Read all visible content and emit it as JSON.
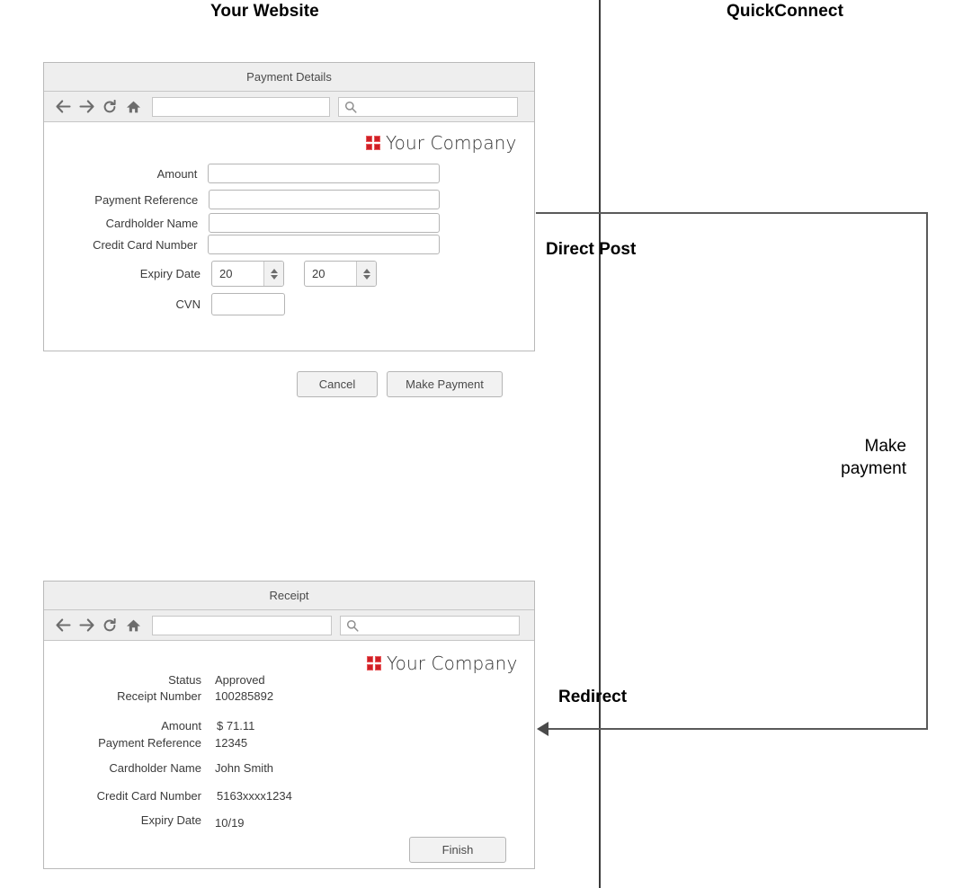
{
  "diagram": {
    "columns": {
      "left_title": "Your Website",
      "right_title": "QuickConnect"
    },
    "flows": [
      {
        "label": "Direct Post",
        "direction": "left-to-right"
      },
      {
        "label": "Redirect",
        "direction": "right-to-left"
      }
    ],
    "right_annotation": "Make\npayment",
    "right_annotation_line1": "Make",
    "right_annotation_line2": "payment"
  },
  "payment_window": {
    "title": "Payment Details",
    "toolbar": {
      "back_icon": "arrow-left-icon",
      "forward_icon": "arrow-right-icon",
      "reload_icon": "reload-icon",
      "home_icon": "home-icon",
      "url_value": "",
      "url_placeholder": "",
      "search_value": "",
      "search_placeholder": "",
      "search_icon": "search-icon"
    },
    "brand": {
      "logo_icon": "four-squares-logo-icon",
      "name": "Your Company",
      "color": "#cf2026"
    },
    "fields": [
      {
        "label": "Amount",
        "value": ""
      },
      {
        "label": "Payment Reference",
        "value": ""
      },
      {
        "label": "Cardholder Name",
        "value": ""
      },
      {
        "label": "Credit Card Number",
        "value": ""
      }
    ],
    "expiry": {
      "label": "Expiry Date",
      "month_value": "20",
      "year_value": "20"
    },
    "cvn": {
      "label": "CVN",
      "value": ""
    },
    "buttons": {
      "cancel": "Cancel",
      "submit": "Make Payment"
    }
  },
  "receipt_window": {
    "title": "Receipt",
    "toolbar": {
      "back_icon": "arrow-left-icon",
      "forward_icon": "arrow-right-icon",
      "reload_icon": "reload-icon",
      "home_icon": "home-icon",
      "url_value": "",
      "url_placeholder": "",
      "search_value": "",
      "search_placeholder": "",
      "search_icon": "search-icon"
    },
    "brand": {
      "logo_icon": "four-squares-logo-icon",
      "name": "Your Company",
      "color": "#cf2026"
    },
    "details": [
      {
        "label": "Status",
        "value": "Approved"
      },
      {
        "label": "Receipt Number",
        "value": "100285892"
      },
      {
        "label": "Amount",
        "value": "$ 71.11"
      },
      {
        "label": "Payment Reference",
        "value": "12345"
      },
      {
        "label": "Cardholder Name",
        "value": "John Smith"
      },
      {
        "label": "Credit Card Number",
        "value": "5163xxxx1234"
      },
      {
        "label": "Expiry Date",
        "value": "10/19"
      }
    ],
    "buttons": {
      "finish": "Finish"
    }
  }
}
